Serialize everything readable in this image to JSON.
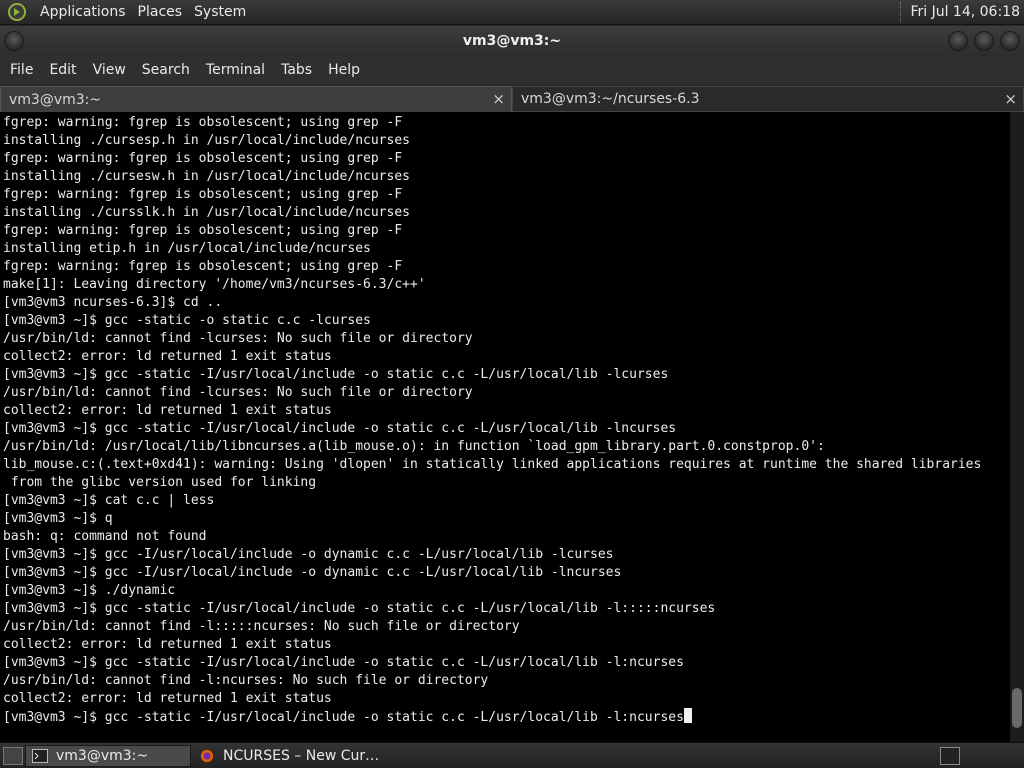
{
  "top_panel": {
    "menus": [
      "Applications",
      "Places",
      "System"
    ],
    "clock": "Fri Jul 14, 06:18"
  },
  "window": {
    "title": "vm3@vm3:~"
  },
  "menubar": {
    "items": [
      "File",
      "Edit",
      "View",
      "Search",
      "Terminal",
      "Tabs",
      "Help"
    ]
  },
  "tabs": [
    {
      "label": "vm3@vm3:~",
      "close": "×"
    },
    {
      "label": "vm3@vm3:~/ncurses-6.3",
      "close": "×"
    }
  ],
  "terminal": {
    "lines": [
      "fgrep: warning: fgrep is obsolescent; using grep -F",
      "installing ./cursesp.h in /usr/local/include/ncurses",
      "fgrep: warning: fgrep is obsolescent; using grep -F",
      "installing ./cursesw.h in /usr/local/include/ncurses",
      "fgrep: warning: fgrep is obsolescent; using grep -F",
      "installing ./cursslk.h in /usr/local/include/ncurses",
      "fgrep: warning: fgrep is obsolescent; using grep -F",
      "installing etip.h in /usr/local/include/ncurses",
      "fgrep: warning: fgrep is obsolescent; using grep -F",
      "make[1]: Leaving directory '/home/vm3/ncurses-6.3/c++'",
      "[vm3@vm3 ncurses-6.3]$ cd ..",
      "[vm3@vm3 ~]$ gcc -static -o static c.c -lcurses",
      "/usr/bin/ld: cannot find -lcurses: No such file or directory",
      "collect2: error: ld returned 1 exit status",
      "[vm3@vm3 ~]$ gcc -static -I/usr/local/include -o static c.c -L/usr/local/lib -lcurses",
      "/usr/bin/ld: cannot find -lcurses: No such file or directory",
      "collect2: error: ld returned 1 exit status",
      "[vm3@vm3 ~]$ gcc -static -I/usr/local/include -o static c.c -L/usr/local/lib -lncurses",
      "/usr/bin/ld: /usr/local/lib/libncurses.a(lib_mouse.o): in function `load_gpm_library.part.0.constprop.0':",
      "lib_mouse.c:(.text+0xd41): warning: Using 'dlopen' in statically linked applications requires at runtime the shared libraries",
      " from the glibc version used for linking",
      "[vm3@vm3 ~]$ cat c.c | less",
      "[vm3@vm3 ~]$ q",
      "bash: q: command not found",
      "[vm3@vm3 ~]$ gcc -I/usr/local/include -o dynamic c.c -L/usr/local/lib -lcurses",
      "[vm3@vm3 ~]$ gcc -I/usr/local/include -o dynamic c.c -L/usr/local/lib -lncurses",
      "[vm3@vm3 ~]$ ./dynamic",
      "[vm3@vm3 ~]$ gcc -static -I/usr/local/include -o static c.c -L/usr/local/lib -l:::::ncurses",
      "/usr/bin/ld: cannot find -l:::::ncurses: No such file or directory",
      "collect2: error: ld returned 1 exit status",
      "[vm3@vm3 ~]$ gcc -static -I/usr/local/include -o static c.c -L/usr/local/lib -l:ncurses",
      "/usr/bin/ld: cannot find -l:ncurses: No such file or directory",
      "collect2: error: ld returned 1 exit status"
    ],
    "prompt_line": "[vm3@vm3 ~]$ gcc -static -I/usr/local/include -o static c.c -L/usr/local/lib -l:ncurses"
  },
  "taskbar": {
    "items": [
      {
        "label": "vm3@vm3:~",
        "icon": "terminal-icon"
      },
      {
        "label": "NCURSES – New Cur…",
        "icon": "firefox-icon"
      }
    ]
  }
}
